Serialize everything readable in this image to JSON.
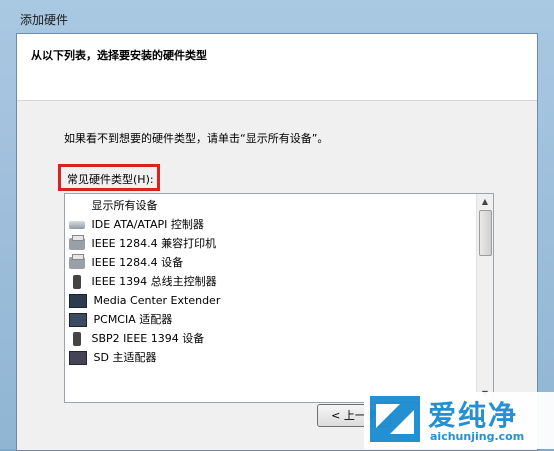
{
  "window": {
    "title": "添加硬件"
  },
  "header": {
    "heading": "从以下列表，选择要安装的硬件类型"
  },
  "instruction": "如果看不到想要的硬件类型，请单击“显示所有设备”。",
  "hardware_label": "常见硬件类型(H):",
  "hardware_list": [
    {
      "label": "显示所有设备",
      "icon": "none"
    },
    {
      "label": "IDE ATA/ATAPI 控制器",
      "icon": "drive-icon"
    },
    {
      "label": "IEEE 1284.4 兼容打印机",
      "icon": "printer-icon"
    },
    {
      "label": "IEEE 1284.4 设备",
      "icon": "printer-icon"
    },
    {
      "label": "IEEE 1394 总线主控制器",
      "icon": "usb-connector-icon"
    },
    {
      "label": "Media Center Extender",
      "icon": "monitor-icon"
    },
    {
      "label": "PCMCIA 适配器",
      "icon": "pcmcia-card-icon"
    },
    {
      "label": "SBP2 IEEE 1394 设备",
      "icon": "usb-connector-icon"
    },
    {
      "label": "SD 主适配器",
      "icon": "sd-card-icon"
    }
  ],
  "buttons": {
    "back": "< 上一步"
  },
  "watermark": {
    "name": "爱纯净",
    "url": "aichunjing.com"
  },
  "colors": {
    "highlight_border": "#d9231f",
    "brand": "#1a8bd0"
  }
}
